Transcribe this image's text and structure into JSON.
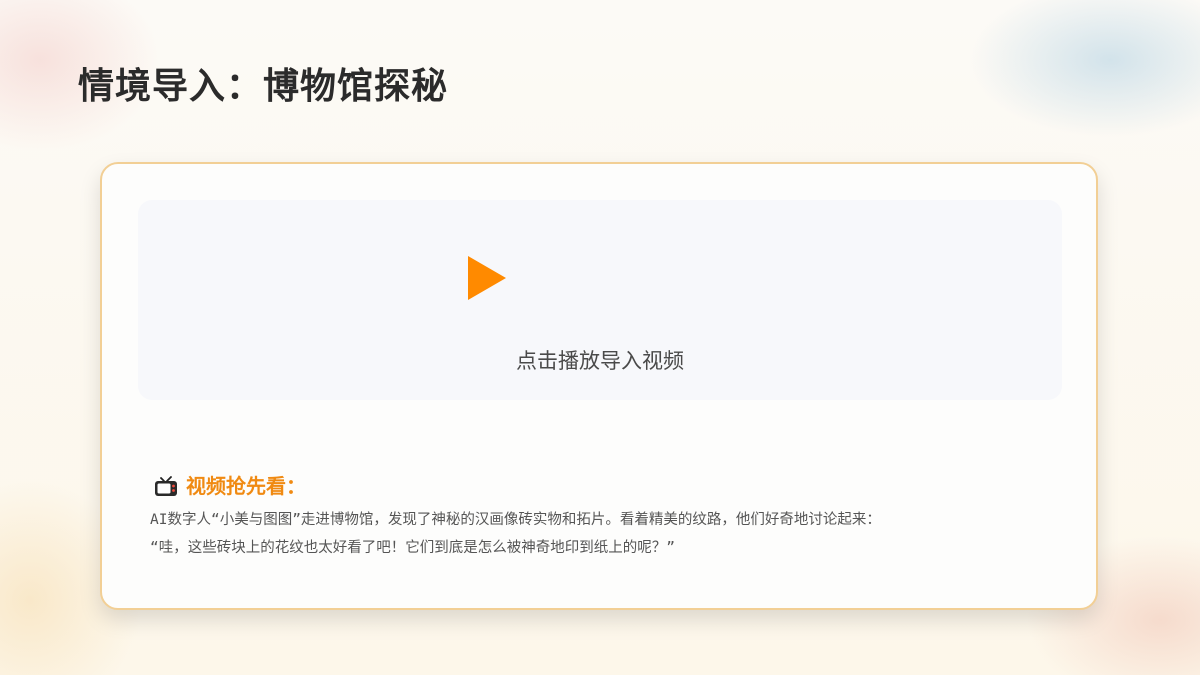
{
  "slide": {
    "title": "情境导入：博物馆探秘"
  },
  "video": {
    "play_icon": "play-icon",
    "caption": "点击播放导入视频"
  },
  "preview": {
    "icon": "tv-icon",
    "label": "视频抢先看：",
    "lines": [
      "AI数字人“小美与图图”走进博物馆，发现了神秘的汉画像砖实物和拓片。看着精美的纹路，他们好奇地讨论起来：",
      "“哇，这些砖块上的花纹也太好看了吧！它们到底是怎么被神奇地印到纸上的呢？”"
    ]
  },
  "colors": {
    "accent": "#ff8a00",
    "label": "#f08a12",
    "card_border": "#f2cf95",
    "title": "#2b2b2b",
    "body_text": "#555555"
  }
}
